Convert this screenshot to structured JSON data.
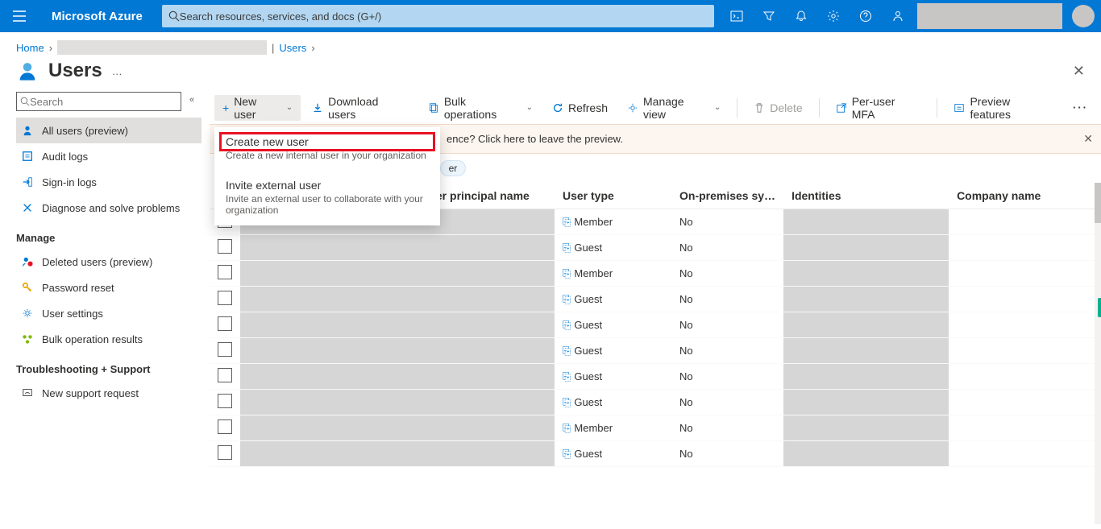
{
  "topbar": {
    "brand": "Microsoft Azure",
    "search_placeholder": "Search resources, services, and docs (G+/)"
  },
  "breadcrumb": {
    "home": "Home",
    "users": "Users"
  },
  "page": {
    "title": "Users"
  },
  "sidebar": {
    "search_placeholder": "Search",
    "items": [
      {
        "label": "All users (preview)",
        "icon": "user",
        "active": true
      },
      {
        "label": "Audit logs",
        "icon": "log"
      },
      {
        "label": "Sign-in logs",
        "icon": "signin"
      },
      {
        "label": "Diagnose and solve problems",
        "icon": "diag"
      }
    ],
    "manage_header": "Manage",
    "manage_items": [
      {
        "label": "Deleted users (preview)",
        "icon": "deleted"
      },
      {
        "label": "Password reset",
        "icon": "key"
      },
      {
        "label": "User settings",
        "icon": "gear"
      },
      {
        "label": "Bulk operation results",
        "icon": "bulk"
      }
    ],
    "troubleshoot_header": "Troubleshooting + Support",
    "troubleshoot_items": [
      {
        "label": "New support request",
        "icon": "support"
      }
    ]
  },
  "commands": {
    "new_user": "New user",
    "download": "Download users",
    "bulk": "Bulk operations",
    "refresh": "Refresh",
    "manage_view": "Manage view",
    "delete": "Delete",
    "per_user_mfa": "Per-user MFA",
    "preview_features": "Preview features"
  },
  "dropdown": {
    "create_title": "Create new user",
    "create_desc": "Create a new internal user in your organization",
    "invite_title": "Invite external user",
    "invite_desc": "Invite an external user to collaborate with your organization"
  },
  "banner": {
    "text_suffix": "ence? Click here to leave the preview."
  },
  "chips": {
    "example": "er"
  },
  "table": {
    "columns": {
      "upn": "User principal name",
      "user_type": "User type",
      "onprem": "On-premises sy…",
      "identities": "Identities",
      "company": "Company name"
    },
    "rows": [
      {
        "user_type": "Member",
        "onprem": "No"
      },
      {
        "user_type": "Guest",
        "onprem": "No"
      },
      {
        "user_type": "Member",
        "onprem": "No"
      },
      {
        "user_type": "Guest",
        "onprem": "No"
      },
      {
        "user_type": "Guest",
        "onprem": "No"
      },
      {
        "user_type": "Guest",
        "onprem": "No"
      },
      {
        "user_type": "Guest",
        "onprem": "No"
      },
      {
        "user_type": "Guest",
        "onprem": "No"
      },
      {
        "user_type": "Member",
        "onprem": "No"
      },
      {
        "user_type": "Guest",
        "onprem": "No"
      }
    ]
  }
}
